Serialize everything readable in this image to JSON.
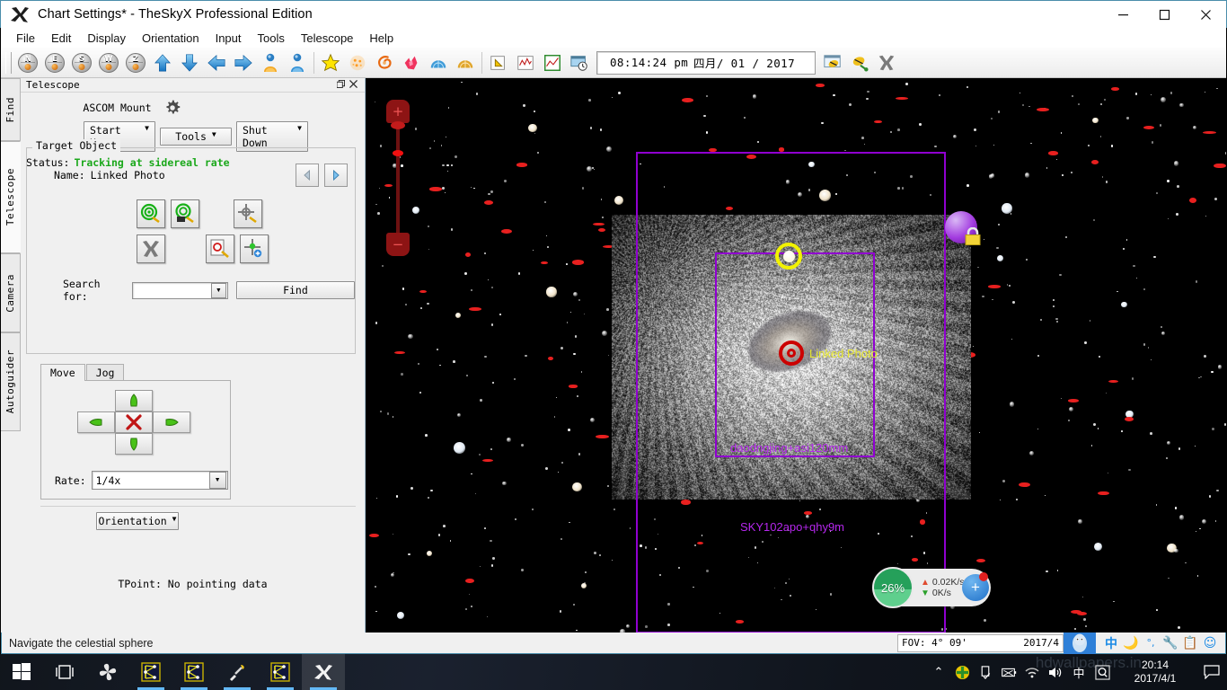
{
  "window": {
    "title": "Chart Settings* - TheSkyX Professional Edition",
    "app_icon": "x-logo-icon",
    "minimize": "minimize-icon",
    "maximize": "maximize-icon",
    "close": "close-icon"
  },
  "menu": {
    "items": [
      "File",
      "Edit",
      "Display",
      "Orientation",
      "Input",
      "Tools",
      "Telescope",
      "Help"
    ]
  },
  "toolbar": {
    "compass": [
      {
        "label": "N",
        "name": "look-north-button"
      },
      {
        "label": "E",
        "name": "look-east-button"
      },
      {
        "label": "S",
        "name": "look-south-button"
      },
      {
        "label": "W",
        "name": "look-west-button"
      },
      {
        "label": "Z",
        "name": "look-zenith-button"
      }
    ],
    "arrows": [
      "arrow-up-icon",
      "arrow-down-icon",
      "arrow-left-icon",
      "arrow-right-icon"
    ],
    "people": [
      "observer-orange-icon",
      "observer-blue-icon"
    ],
    "objects": [
      "star-yellow-icon",
      "open-cluster-icon",
      "galaxy-spiral-icon",
      "nebula-icon",
      "sky-dome-blue-icon",
      "sky-dome-orange-icon"
    ],
    "tools": [
      "label-tag-icon",
      "light-curve-icon",
      "chart-frame-icon",
      "time-skip-icon"
    ],
    "datetime": {
      "time": "08:14:24 pm",
      "date": "四月/ 01 / 2017"
    },
    "right_tools": [
      "bee-flashlight-icon",
      "bee-connect-icon",
      "x-close-icon"
    ]
  },
  "left_dock": {
    "vertical_tabs": [
      {
        "label": "Find",
        "active": false
      },
      {
        "label": "Telescope",
        "active": true
      },
      {
        "label": "Camera",
        "active": false
      },
      {
        "label": "Autoguider",
        "active": false
      }
    ],
    "panel": {
      "title": "Telescope",
      "undock_icon": "undock-icon",
      "close_icon": "close-icon",
      "mount_label": "ASCOM Mount",
      "settings_icon": "gear-icon",
      "buttons": [
        {
          "label": "Start Up",
          "name": "start-up-button"
        },
        {
          "label": "Tools",
          "name": "tools-button"
        },
        {
          "label": "Shut Down",
          "name": "shut-down-button"
        }
      ],
      "status_label": "Status:",
      "status_value": "Tracking at sidereal rate",
      "group_title": "Target Object",
      "name_label": "Name:",
      "name_value": "Linked Photo",
      "prev_icon": "previous-target-icon",
      "next_icon": "next-target-icon",
      "action_icons": [
        "slew-to-target-icon",
        "slew-and-image-icon",
        "center-target-icon",
        "abort-slew-icon",
        "sync-photo-icon",
        "sync-target-icon"
      ],
      "search_label": "Search for:",
      "search_value": "",
      "find_label": "Find",
      "move_tabs": [
        {
          "label": "Move",
          "selected": true
        },
        {
          "label": "Jog",
          "selected": false
        }
      ],
      "direction_icons": [
        "move-up-icon",
        "move-left-icon",
        "stop-move-icon",
        "move-right-icon",
        "move-down-icon"
      ],
      "rate_label": "Rate:",
      "rate_value": "1/4x",
      "orientation_label": "Orientation",
      "tpoint_text": "TPoint: No pointing data"
    }
  },
  "sky_chart": {
    "zoom_slider": {
      "plus": "+",
      "minus": "−",
      "name": "zoom-slider"
    },
    "fov_outer": {
      "label": "SKY102apo+qhy9m",
      "color": "#b527ed"
    },
    "fov_inner": {
      "label": "daodngjing+asi120mm",
      "color": "#b527ed"
    },
    "target_label": "Linked Photo",
    "target_label_color": "#e6e62e",
    "objects": [
      "sun-icon",
      "locked-object-icon",
      "galaxy-image"
    ],
    "network_widget": {
      "percent": "26%",
      "up_speed": "0.02K/s",
      "down_speed": "0K/s",
      "up_icon": "arrow-up-icon",
      "down_icon": "arrow-down-icon",
      "add_icon": "plus-icon"
    }
  },
  "status_bar": {
    "hint": "Navigate the celestial sphere",
    "fov": "FOV: 4°  09'",
    "date": "2017/4",
    "qq_icon": "qq-penguin-icon",
    "tray": [
      "ime-chinese-icon",
      "moon-icon",
      "punctuation-icon",
      "toolbox-icon",
      "clipboard-icon",
      "smiley-icon"
    ]
  },
  "taskbar": {
    "start_icon": "windows-start-icon",
    "taskview_icon": "task-view-icon",
    "apps": [
      {
        "name": "taskbar-item-fan",
        "icon": "fan-icon",
        "active": false
      },
      {
        "name": "taskbar-item-skyx-1",
        "icon": "chart-icon",
        "active": false
      },
      {
        "name": "taskbar-item-skyx-2",
        "icon": "chart-icon",
        "active": false
      },
      {
        "name": "taskbar-item-tool",
        "icon": "pen-icon",
        "active": false
      },
      {
        "name": "taskbar-item-skyx-3",
        "icon": "chart-icon",
        "active": false
      },
      {
        "name": "taskbar-item-theskyx",
        "icon": "x-logo-icon",
        "active": true
      }
    ],
    "tray": [
      "chevron-up-icon",
      "shield-green-icon",
      "usb-icon",
      "battery-icon",
      "wifi-icon",
      "volume-icon",
      "ime-chinese-icon",
      "search-q-icon"
    ],
    "clock_time": "20:14",
    "clock_date": "2017/4/1",
    "notification_icon": "notification-icon",
    "watermark": "hdwallpapers.in"
  }
}
